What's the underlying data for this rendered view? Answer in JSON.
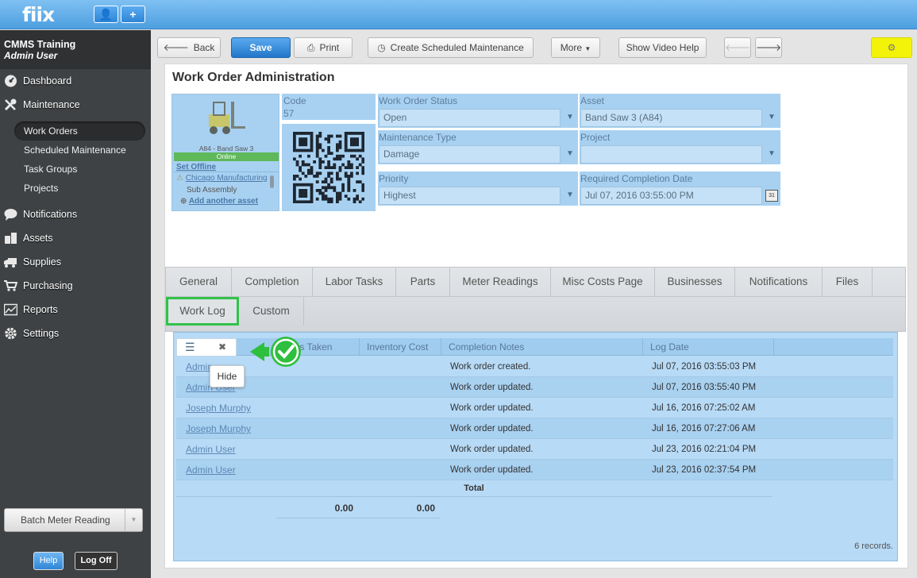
{
  "app": {
    "logo": "fiix",
    "user_btn": "👤",
    "add_btn": "+"
  },
  "sidebar": {
    "org": "CMMS Training",
    "user": "Admin User",
    "items": [
      {
        "label": "Dashboard",
        "icon": "dashboard-icon"
      },
      {
        "label": "Maintenance",
        "icon": "wrench-icon"
      },
      {
        "label": "Notifications",
        "icon": "speech-bubble-icon"
      },
      {
        "label": "Assets",
        "icon": "boxes-icon"
      },
      {
        "label": "Supplies",
        "icon": "truck-icon"
      },
      {
        "label": "Purchasing",
        "icon": "cart-icon"
      },
      {
        "label": "Reports",
        "icon": "chart-icon"
      },
      {
        "label": "Settings",
        "icon": "gear-icon"
      }
    ],
    "sub_items": [
      "Work Orders",
      "Scheduled Maintenance",
      "Task Groups",
      "Projects"
    ],
    "batch": "Batch Meter Reading",
    "help": "Help",
    "logoff": "Log Off"
  },
  "toolbar": {
    "back": "Back",
    "save": "Save",
    "print": "Print",
    "create_sched": "Create Scheduled Maintenance",
    "more": "More",
    "video_help": "Show Video Help"
  },
  "page": {
    "title": "Work Order Administration"
  },
  "asset_card": {
    "caption": "A84 - Band Saw 3",
    "status": "Online",
    "set_offline": "Set Offline",
    "site": "Chicago Manufacturing",
    "sub": "Sub Assembly",
    "add_asset": "Add another asset"
  },
  "form": {
    "code_label": "Code",
    "code_value": "57",
    "status_label": "Work Order Status",
    "status_value": "Open",
    "asset_label": "Asset",
    "asset_value": "Band Saw 3 (A84)",
    "mtype_label": "Maintenance Type",
    "mtype_value": "Damage",
    "project_label": "Project",
    "project_value": "",
    "priority_label": "Priority",
    "priority_value": "Highest",
    "rcd_label": "Required Completion Date",
    "rcd_value": "Jul 07, 2016 03:55:00 PM",
    "cal": "31"
  },
  "tabs": [
    "General",
    "Completion",
    "Labor Tasks",
    "Parts",
    "Meter Readings",
    "Misc Costs Page",
    "Businesses",
    "Notifications",
    "Files"
  ],
  "tabs2": [
    "Work Log",
    "Custom"
  ],
  "grid": {
    "headers": [
      "Hours Taken",
      "Inventory Cost",
      "Completion Notes",
      "Log Date"
    ],
    "header_visible": [
      "ours Taken",
      "Inventory Cost",
      "Completion Notes",
      "Log Date"
    ],
    "rows": [
      {
        "user": "Admin",
        "notes": "Work order created.",
        "date": "Jul 07, 2016 03:55:03 PM"
      },
      {
        "user": "Admin User",
        "notes": "Work order updated.",
        "date": "Jul 07, 2016 03:55:40 PM"
      },
      {
        "user": "Joseph Murphy",
        "notes": "Work order updated.",
        "date": "Jul 16, 2016 07:25:02 AM"
      },
      {
        "user": "Joseph Murphy",
        "notes": "Work order updated.",
        "date": "Jul 16, 2016 07:27:06 AM"
      },
      {
        "user": "Admin User",
        "notes": "Work order updated.",
        "date": "Jul 23, 2016 02:21:04 PM"
      },
      {
        "user": "Admin User",
        "notes": "Work order updated.",
        "date": "Jul 23, 2016 02:37:54 PM"
      }
    ],
    "total_label": "Total",
    "total_hours": "0.00",
    "total_cost": "0.00",
    "records": "6 records.",
    "hide_tip": "Hide",
    "menu_icon": "☰",
    "close_icon": "✖"
  }
}
